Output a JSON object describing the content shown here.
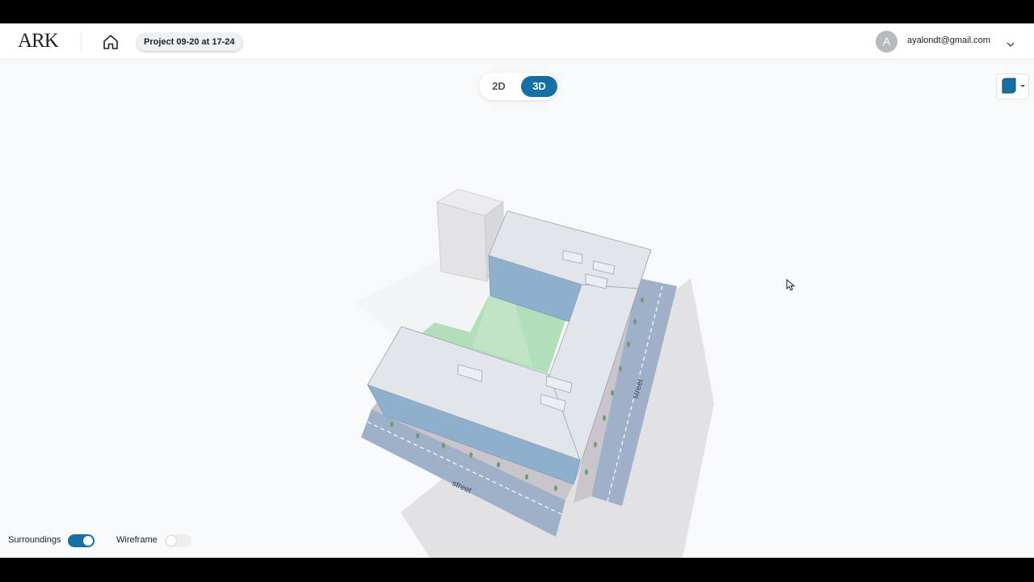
{
  "header": {
    "logo": "ARK",
    "home_icon": "home-icon",
    "project_name": "Project 09-20 at 17-24",
    "user_initial": "A",
    "user_email": "ayalondt@gmail.com",
    "menu_icon": "chevron-down-icon"
  },
  "view_toggle": {
    "option_2d": "2D",
    "option_3d": "3D",
    "selected": "3D"
  },
  "view_button": {
    "icon": "cube-icon"
  },
  "scene": {
    "street_label_south": "street",
    "street_label_east": "street"
  },
  "bottom_controls": {
    "surroundings_label": "Surroundings",
    "surroundings_on": true,
    "wireframe_label": "Wireframe",
    "wireframe_on": false
  },
  "colors": {
    "accent": "#1670a4",
    "facade": "#8fb0cc",
    "roof": "#e1e6ea",
    "courtyard": "#b3deba",
    "street": "#9fb1c8"
  }
}
